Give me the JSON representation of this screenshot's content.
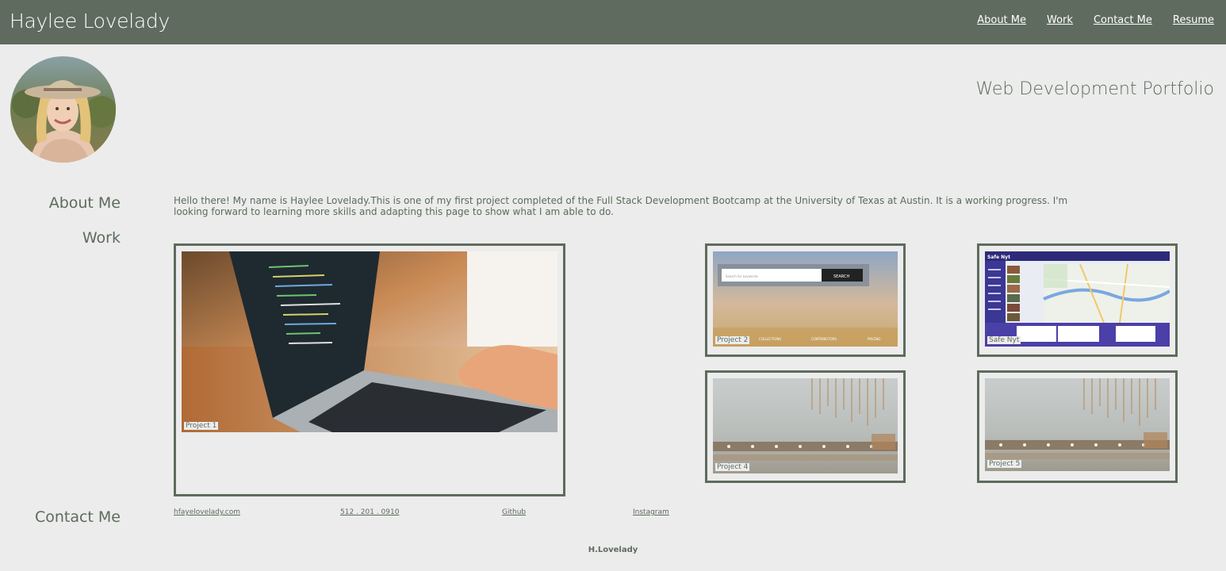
{
  "header": {
    "brand": "Haylee Lovelady",
    "nav": [
      "About Me",
      "Work",
      "Contact Me",
      "Resume"
    ]
  },
  "hero": {
    "subtitle": "Web Development Portfolio"
  },
  "sections": {
    "about_heading": "About Me",
    "work_heading": "Work",
    "contact_heading": "Contact Me"
  },
  "about": {
    "text": "Hello there! My name is Haylee Lovelady.This is one of my first project completed of the Full Stack Development Bootcamp at the University of Texas at Austin. It is a working progress. I'm looking forward to learning more skills and adapting this page to show what I am able to do."
  },
  "work": {
    "projects": [
      {
        "label": "Project 1"
      },
      {
        "label": "Project 2"
      },
      {
        "label": "Safe Nyt"
      },
      {
        "label": "Project 4"
      },
      {
        "label": "Project 5"
      }
    ],
    "project2_search_placeholder": "Search for keywords",
    "project2_search_button": "SEARCH",
    "project2_nav": [
      "COLLECTIONS",
      "CONTRIBUTORS",
      "PRICING"
    ],
    "safenyt_logo": "Safe Nyt"
  },
  "contact": {
    "email": "hfayelovelady.com",
    "phone": "512 . 201 . 0910",
    "github": "Github",
    "instagram": "Instagram"
  },
  "footer": {
    "text": "H.Lovelady"
  },
  "colors": {
    "accent": "#5f6b5e",
    "background": "#ececec",
    "text": "#5d6b5d"
  }
}
